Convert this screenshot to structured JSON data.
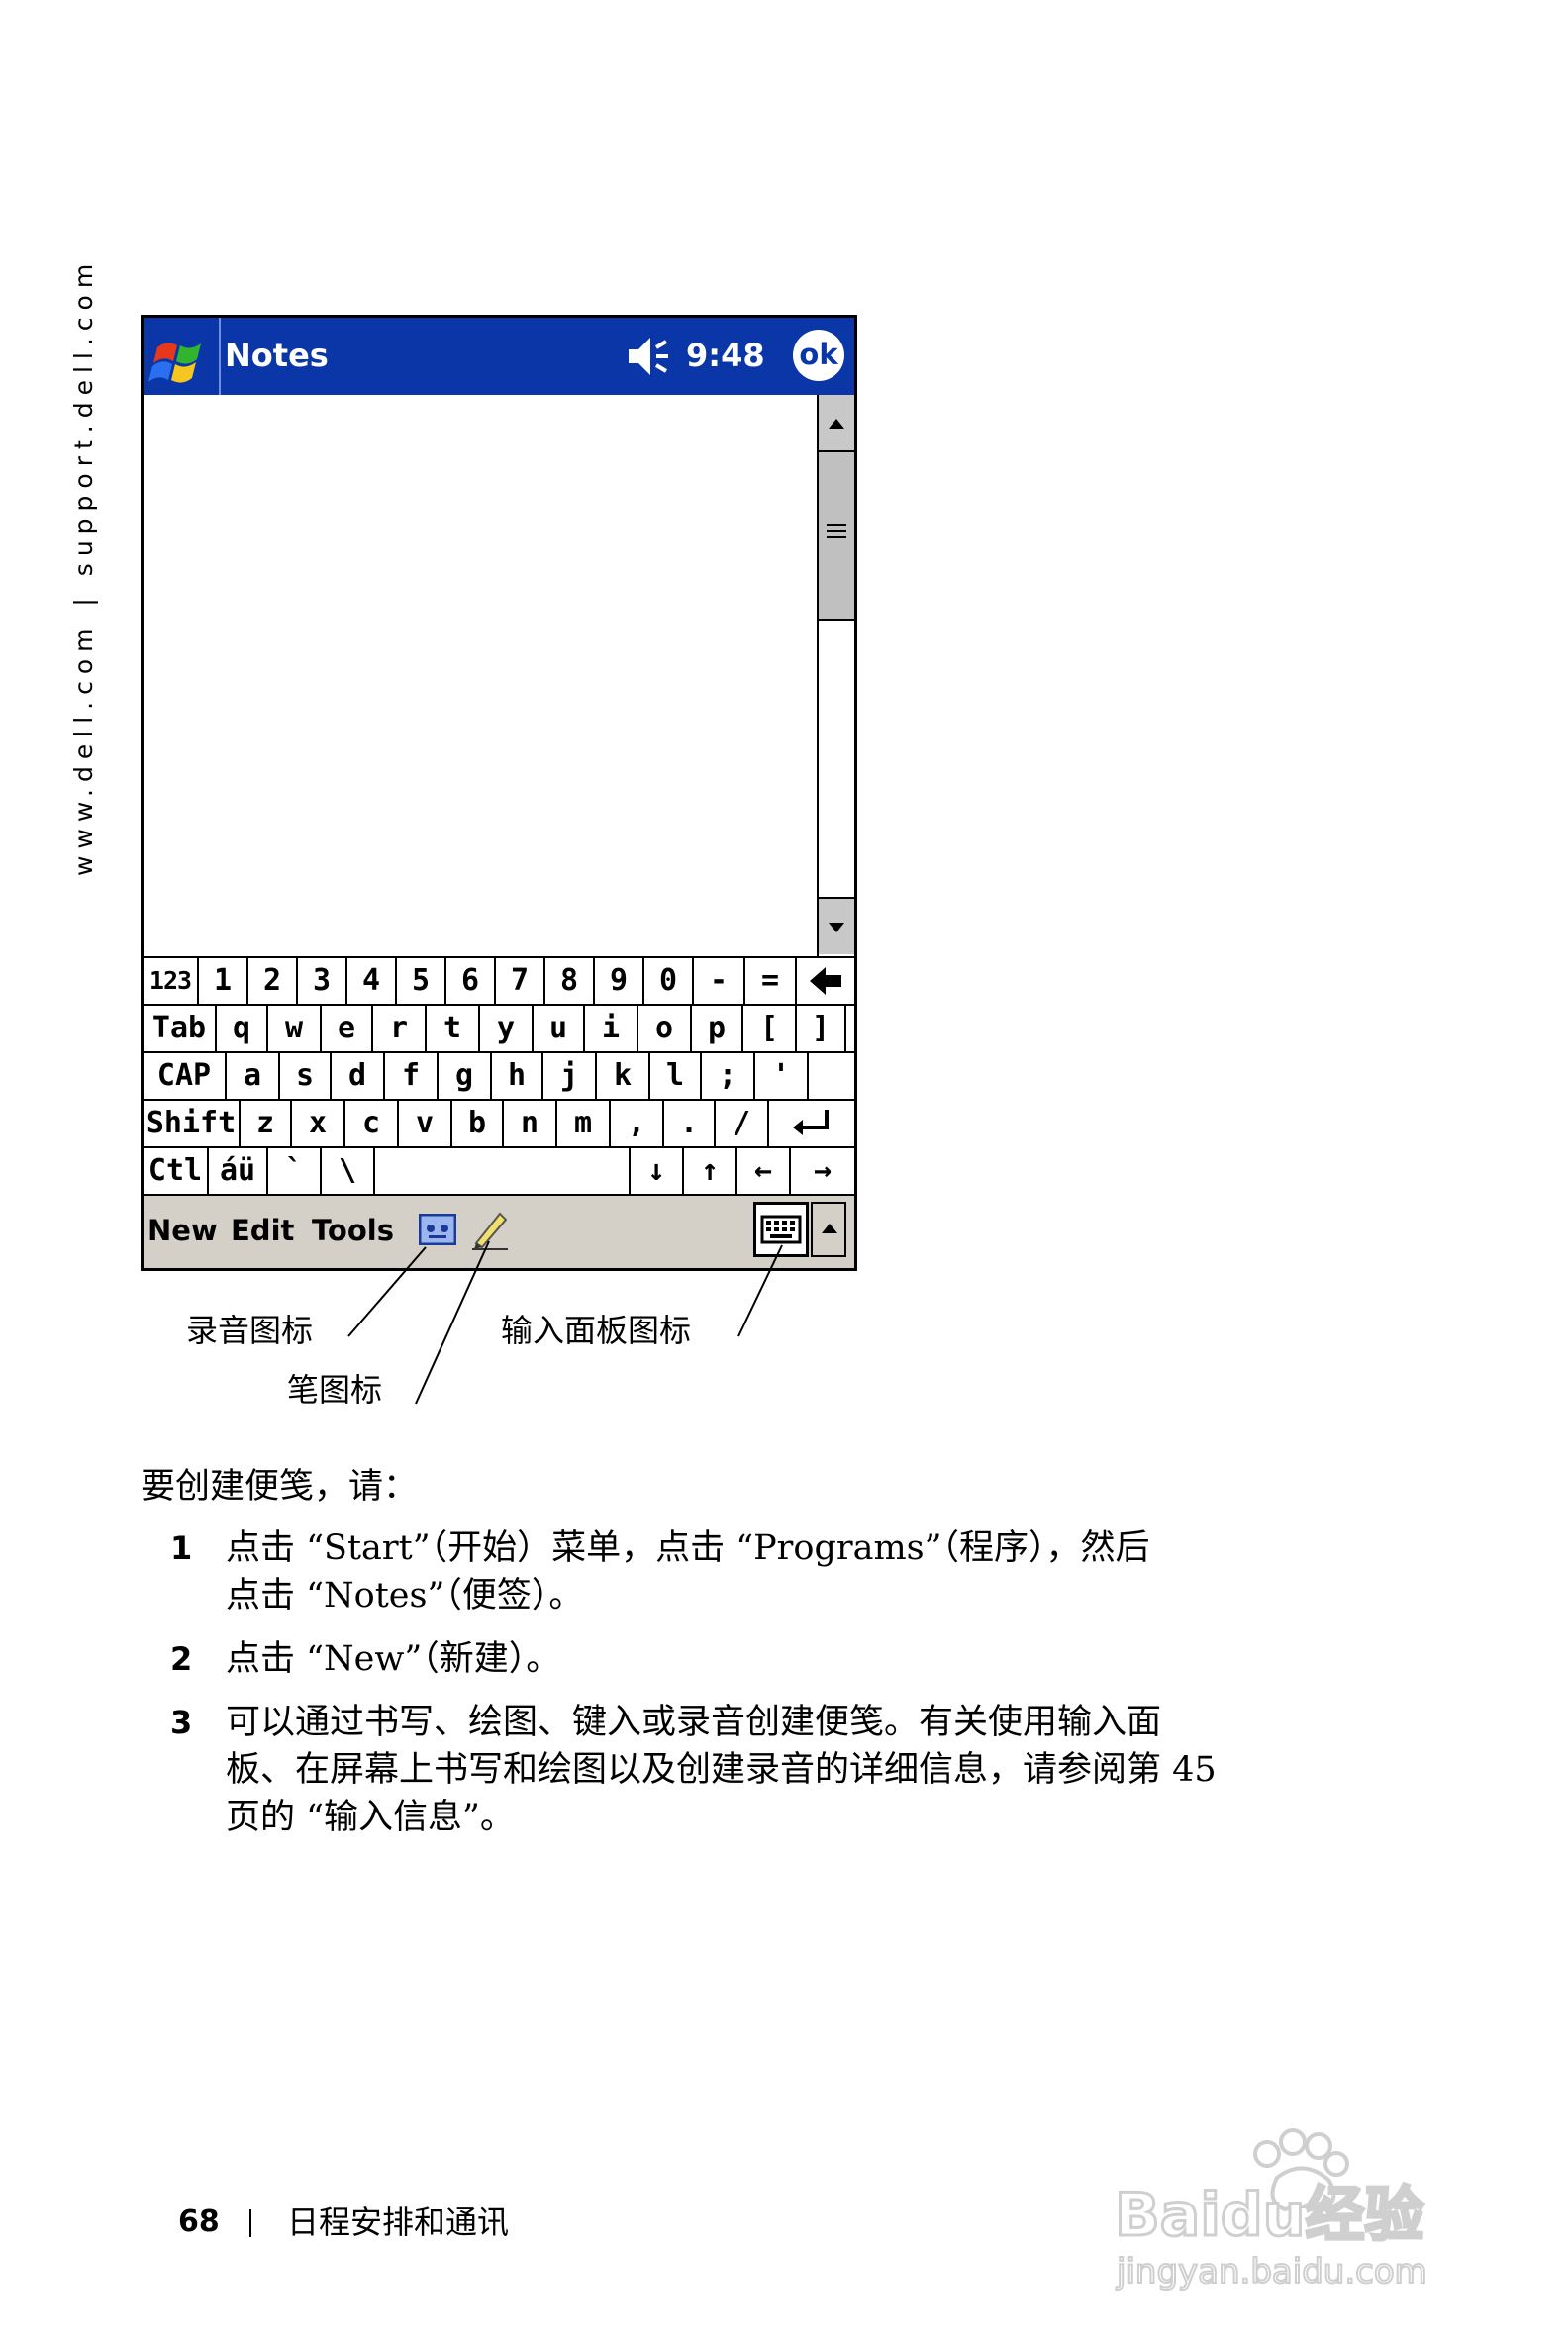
{
  "sidebar_url": "www.dell.com | support.dell.com",
  "pda": {
    "app_title": "Notes",
    "clock": "9:48",
    "ok_label": "ok",
    "keyboard_rows": [
      [
        "123",
        "1",
        "2",
        "3",
        "4",
        "5",
        "6",
        "7",
        "8",
        "9",
        "0",
        "-",
        "=",
        "backspace"
      ],
      [
        "Tab",
        "q",
        "w",
        "e",
        "r",
        "t",
        "y",
        "u",
        "i",
        "o",
        "p",
        "[",
        "]"
      ],
      [
        "CAP",
        "a",
        "s",
        "d",
        "f",
        "g",
        "h",
        "j",
        "k",
        "l",
        ";",
        "'"
      ],
      [
        "Shift",
        "z",
        "x",
        "c",
        "v",
        "b",
        "n",
        "m",
        ",",
        ".",
        "/",
        "enter"
      ],
      [
        "Ctl",
        "áü",
        "`",
        "\\",
        "space",
        "↓",
        "↑",
        "←",
        "→"
      ]
    ],
    "menu": [
      "New",
      "Edit",
      "Tools"
    ],
    "icons": [
      "start-flag-icon",
      "speaker-icon",
      "recording-icon",
      "pen-icon",
      "input-panel-keyboard-icon",
      "scroll-up-icon",
      "scroll-down-icon"
    ]
  },
  "callouts": {
    "recording_icon": "录音图标",
    "pen_icon": "笔图标",
    "input_panel_icon": "输入面板图标"
  },
  "intro": "要创建便笺，请：",
  "steps": [
    {
      "num": "1",
      "line1": "点击 “Start”（开始）菜单，点击 “Programs”（程序），然后",
      "line2": "点击 “Notes”（便签）。"
    },
    {
      "num": "2",
      "line1": "点击 “New”（新建）。"
    },
    {
      "num": "3",
      "line1": "可以通过书写、绘图、键入或录音创建便笺。有关使用输入面",
      "line2": "板、在屏幕上书写和绘图以及创建录音的详细信息，请参阅第 45",
      "line3": "页的 “输入信息”。"
    }
  ],
  "footer": {
    "page_number": "68",
    "section_title": "日程安排和通讯"
  },
  "watermark": {
    "brand": "Baidu经验",
    "url": "jingyan.baidu.com"
  }
}
